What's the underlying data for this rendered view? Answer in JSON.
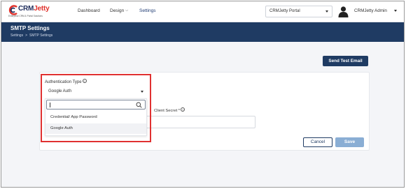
{
  "nav": {
    "logo": {
      "brand_main": "CRM",
      "brand_accent": "Jetty",
      "tagline": "Enterprise CRM & Portal Solutions"
    },
    "items": [
      {
        "label": "Dashboard",
        "has_chevron": false
      },
      {
        "label": "Design",
        "has_chevron": true
      },
      {
        "label": "Settings",
        "has_chevron": false,
        "active": true
      }
    ],
    "portal_select": {
      "value": "CRMJetty Portal"
    },
    "user": {
      "name": "CRMJetty Admin"
    }
  },
  "page_header": {
    "title": "SMTP Settings",
    "breadcrumb": [
      "Settings",
      "SMTP Settings"
    ],
    "breadcrumb_separator": ">"
  },
  "actions": {
    "send_test_email": "Send Test Email"
  },
  "form": {
    "auth_type_label": "Authentication Type",
    "auth_type_value": "Google Auth",
    "client_secret_label": "Client Secret *",
    "help_glyph": "?",
    "dropdown": {
      "search_value": "",
      "options": [
        {
          "label": "Credential/ App Password",
          "selected": false
        },
        {
          "label": "Google Auth",
          "selected": true
        }
      ]
    },
    "buttons": {
      "cancel": "Cancel",
      "save": "Save"
    }
  },
  "colors": {
    "header_bg": "#1f3b63",
    "highlight": "#e03131",
    "save_disabled": "#8aaed4",
    "brand_accent": "#e0322c"
  }
}
